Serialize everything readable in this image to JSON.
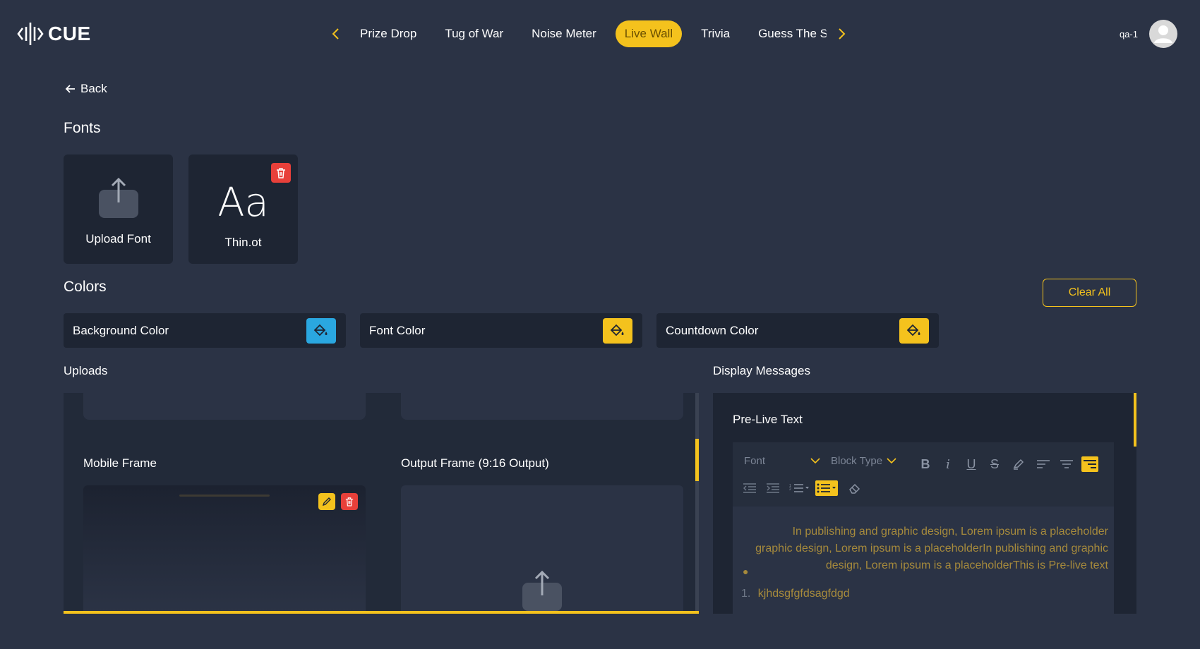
{
  "app": {
    "logo_text": "CUE"
  },
  "nav": {
    "items": [
      {
        "label": "Prize Drop",
        "active": false
      },
      {
        "label": "Tug of War",
        "active": false
      },
      {
        "label": "Noise Meter",
        "active": false
      },
      {
        "label": "Live Wall",
        "active": true
      },
      {
        "label": "Trivia",
        "active": false
      },
      {
        "label": "Guess The Sc",
        "active": false
      }
    ]
  },
  "user": {
    "name": "qa-1"
  },
  "back_label": "Back",
  "fonts": {
    "title": "Fonts",
    "upload_label": "Upload Font",
    "font_preview": "Aa",
    "font_name": "Thin.ot"
  },
  "colors": {
    "title": "Colors",
    "clear_all": "Clear All",
    "rows": [
      {
        "label": "Background Color",
        "swatch": "#2aa7e0"
      },
      {
        "label": "Font Color",
        "swatch": "#f4c21d"
      },
      {
        "label": "Countdown Color",
        "swatch": "#f4c21d"
      }
    ]
  },
  "uploads": {
    "title": "Uploads",
    "mobile_frame": "Mobile Frame",
    "output_frame": "Output Frame (9:16 Output)"
  },
  "display_messages": {
    "title": "Display Messages",
    "prelive_title": "Pre-Live Text",
    "toolbar": {
      "font": "Font",
      "block_type": "Block Type"
    },
    "paragraph": "In publishing and graphic design, Lorem ipsum is a placeholder graphic design, Lorem ipsum is a placeholderIn publishing and graphic design, Lorem ipsum is a placeholderThis is Pre-live text",
    "list_number": "1.",
    "list_item": "kjhdsgfgfdsagfdgd"
  },
  "theme": {
    "accent": "#f4c21d",
    "danger": "#e8403a",
    "background": "#2b3345",
    "panel": "#1e2533"
  }
}
